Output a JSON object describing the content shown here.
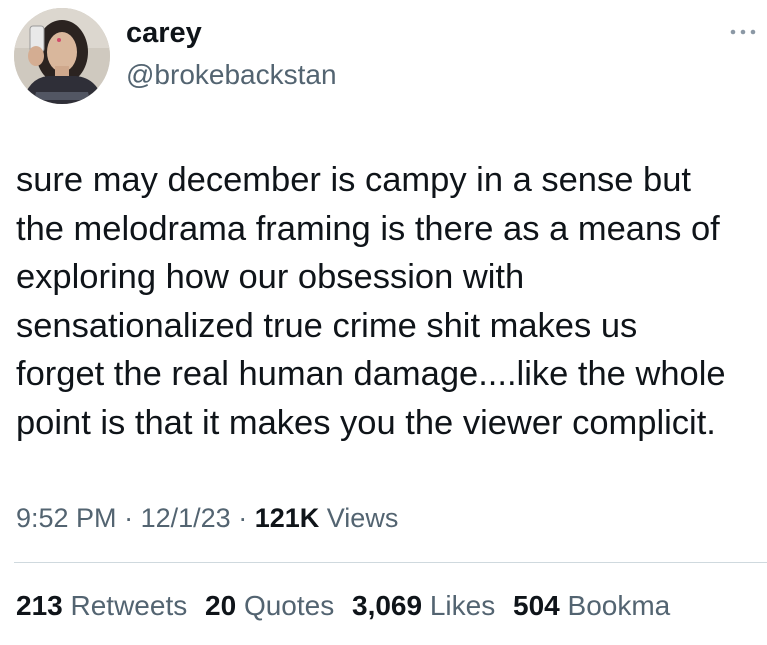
{
  "author": {
    "name": "carey",
    "handle": "@brokebackstan"
  },
  "tweet": {
    "text": "sure may december is campy in a sense but\nthe melodrama framing is there as a means of\nexploring how our obsession with\nsensationalized true crime shit makes us\nforget the real human damage....like the whole\npoint is that it makes you the viewer complicit."
  },
  "meta": {
    "time": "9:52 PM",
    "separator": "·",
    "date": "12/1/23",
    "views_count": "121K",
    "views_label": "Views"
  },
  "stats": [
    {
      "value": "213",
      "label": "Retweets"
    },
    {
      "value": "20",
      "label": "Quotes"
    },
    {
      "value": "3,069",
      "label": "Likes"
    },
    {
      "value": "504",
      "label": "Bookma"
    }
  ],
  "icons": {
    "more": "more-horizontal-icon"
  },
  "colors": {
    "text_primary": "#0f1419",
    "text_secondary": "#536471",
    "divider": "#cfd9de",
    "background": "#ffffff"
  }
}
